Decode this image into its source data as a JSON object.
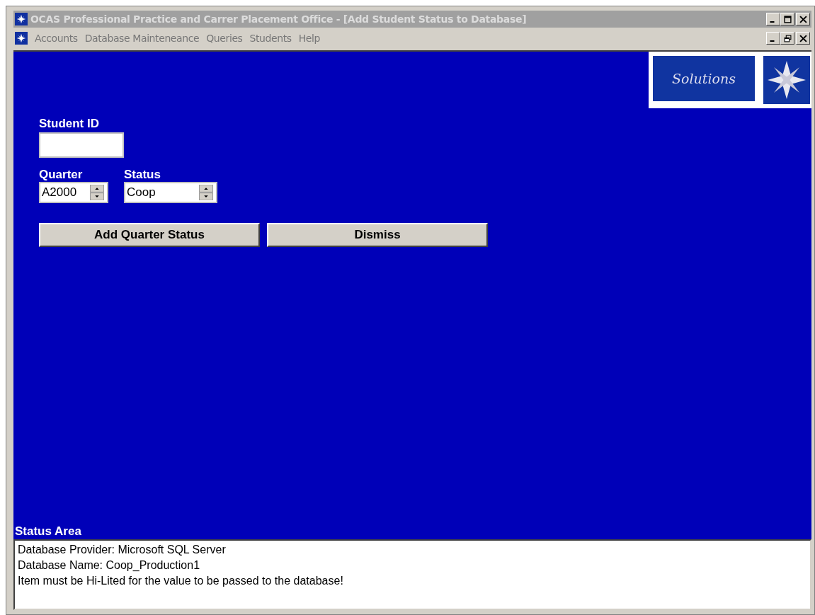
{
  "window": {
    "title": "OCAS Professional Practice and Carrer Placement Office - [Add Student Status to Database]"
  },
  "menu": [
    "Accounts",
    "Database Mainteneance",
    "Queries",
    "Students",
    "Help"
  ],
  "logo": {
    "text": "Solutions"
  },
  "form": {
    "student_id": {
      "label": "Student ID"
    },
    "quarter": {
      "label": "Quarter",
      "value": "A2000"
    },
    "status": {
      "label": "Status",
      "value": "Coop"
    },
    "buttons": [
      "Add Quarter Status",
      "Dismiss"
    ]
  },
  "status_area": {
    "label": "Status Area",
    "lines": [
      "Database Provider: Microsoft SQL Server",
      "Database Name: Coop_Production1",
      "Item must be Hi-Lited for the value to be passed to the database!"
    ]
  }
}
